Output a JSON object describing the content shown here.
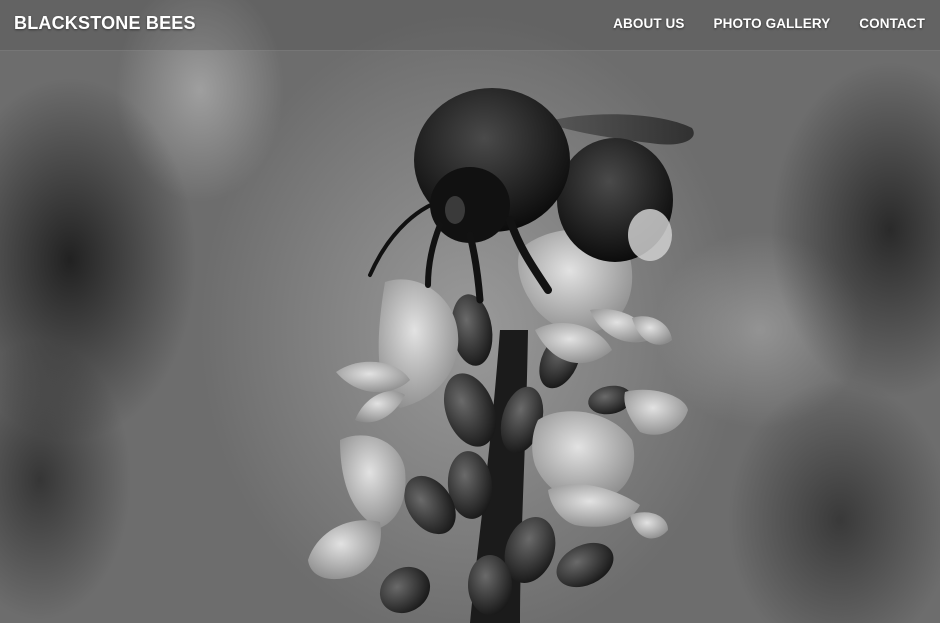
{
  "site": {
    "title": "BLACKSTONE BEES"
  },
  "nav": {
    "items": [
      {
        "label": "ABOUT US"
      },
      {
        "label": "PHOTO GALLERY"
      },
      {
        "label": "CONTACT"
      }
    ]
  },
  "hero": {
    "subject": "bumblebee on lavender flower, black and white photo"
  },
  "colors": {
    "header_text": "#ffffff",
    "background": "#6d6d6d"
  }
}
